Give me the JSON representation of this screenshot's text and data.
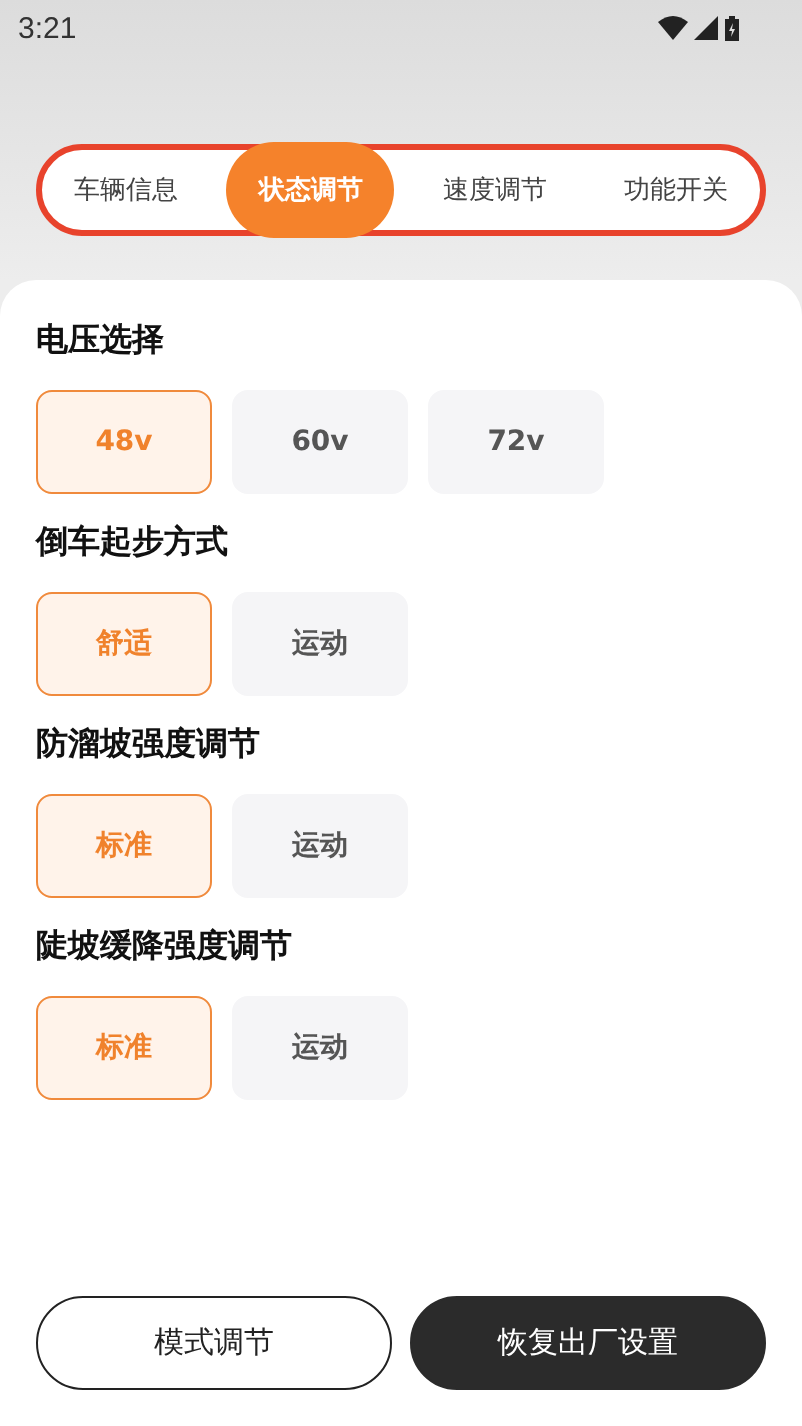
{
  "status_bar": {
    "time": "3:21"
  },
  "tabs": [
    {
      "label": "车辆信息",
      "selected": false
    },
    {
      "label": "状态调节",
      "selected": true
    },
    {
      "label": "速度调节",
      "selected": false
    },
    {
      "label": "功能开关",
      "selected": false
    }
  ],
  "sections": [
    {
      "title": "电压选择",
      "options": [
        {
          "label": "48v",
          "selected": true
        },
        {
          "label": "60v",
          "selected": false
        },
        {
          "label": "72v",
          "selected": false
        }
      ]
    },
    {
      "title": "倒车起步方式",
      "options": [
        {
          "label": "舒适",
          "selected": true
        },
        {
          "label": "运动",
          "selected": false
        }
      ]
    },
    {
      "title": "防溜坡强度调节",
      "options": [
        {
          "label": "标准",
          "selected": true
        },
        {
          "label": "运动",
          "selected": false
        }
      ]
    },
    {
      "title": "陡坡缓降强度调节",
      "options": [
        {
          "label": "标准",
          "selected": true
        },
        {
          "label": "运动",
          "selected": false
        }
      ]
    }
  ],
  "buttons": [
    {
      "label": "模式调节",
      "kind": "outline"
    },
    {
      "label": "恢复出厂设置",
      "kind": "filled"
    }
  ]
}
